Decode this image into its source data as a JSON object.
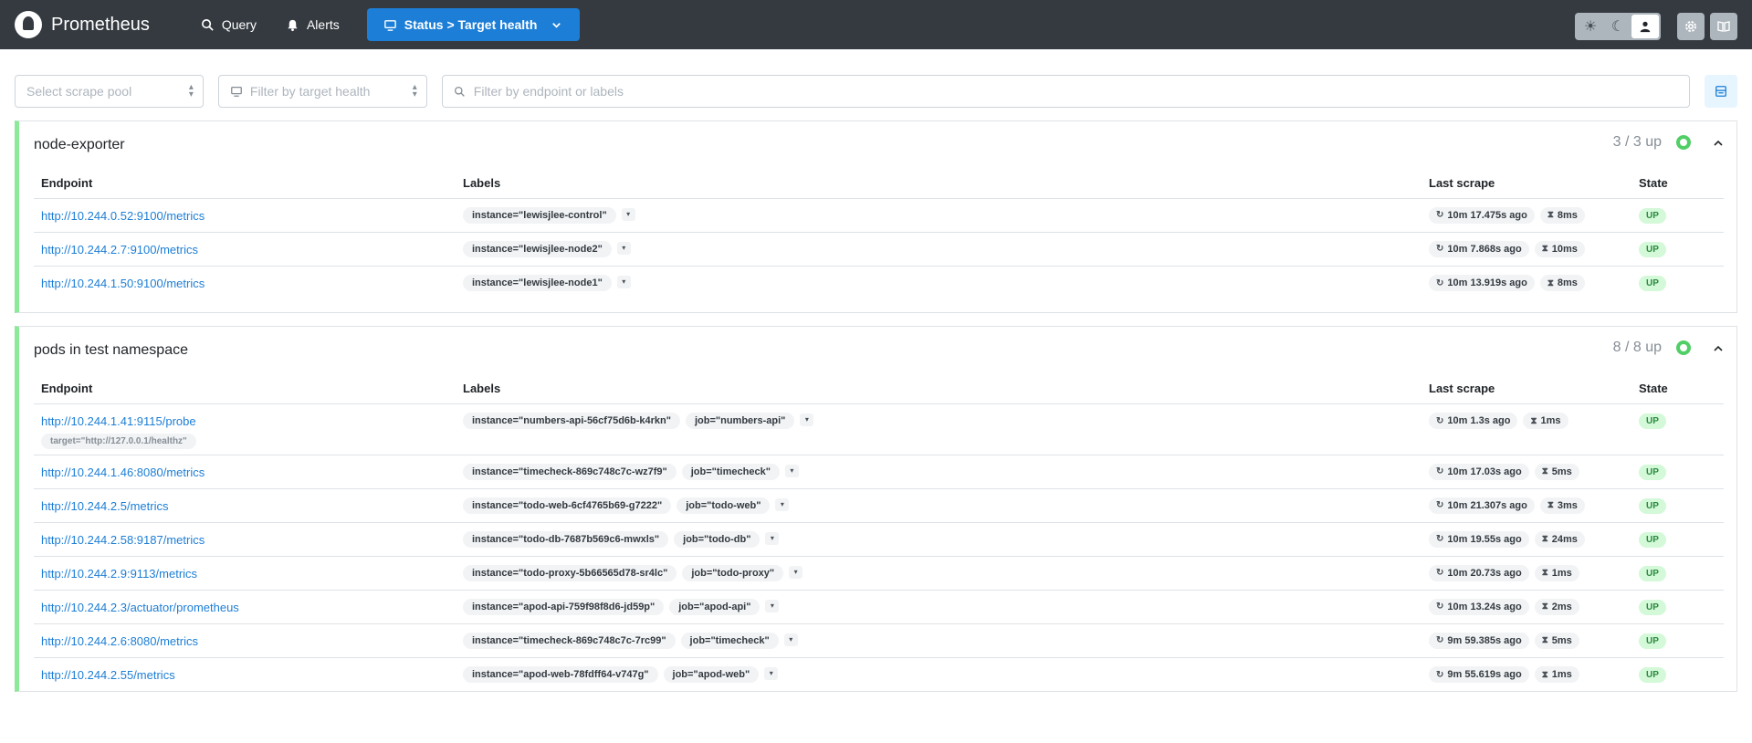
{
  "app": {
    "title": "Prometheus"
  },
  "nav": {
    "query": "Query",
    "alerts": "Alerts",
    "status": "Status > Target health"
  },
  "filters": {
    "scrape_pool_placeholder": "Select scrape pool",
    "health_placeholder": "Filter by target health",
    "search_placeholder": "Filter by endpoint or labels"
  },
  "columns": {
    "endpoint": "Endpoint",
    "labels": "Labels",
    "last_scrape": "Last scrape",
    "state": "State"
  },
  "pools": [
    {
      "name": "node-exporter",
      "count": "3 / 3 up",
      "targets": [
        {
          "endpoint": "http://10.244.0.52:9100/metrics",
          "labels": [
            "instance=\"lewisjlee-control\""
          ],
          "last": "10m 17.475s ago",
          "dur": "8ms",
          "state": "UP"
        },
        {
          "endpoint": "http://10.244.2.7:9100/metrics",
          "labels": [
            "instance=\"lewisjlee-node2\""
          ],
          "last": "10m 7.868s ago",
          "dur": "10ms",
          "state": "UP"
        },
        {
          "endpoint": "http://10.244.1.50:9100/metrics",
          "labels": [
            "instance=\"lewisjlee-node1\""
          ],
          "last": "10m 13.919s ago",
          "dur": "8ms",
          "state": "UP"
        }
      ]
    },
    {
      "name": "pods in test namespace",
      "count": "8 / 8 up",
      "targets": [
        {
          "endpoint": "http://10.244.1.41:9115/probe",
          "extra": "target=\"http://127.0.0.1/healthz\"",
          "labels": [
            "instance=\"numbers-api-56cf75d6b-k4rkn\"",
            "job=\"numbers-api\""
          ],
          "last": "10m 1.3s ago",
          "dur": "1ms",
          "state": "UP"
        },
        {
          "endpoint": "http://10.244.1.46:8080/metrics",
          "labels": [
            "instance=\"timecheck-869c748c7c-wz7f9\"",
            "job=\"timecheck\""
          ],
          "last": "10m 17.03s ago",
          "dur": "5ms",
          "state": "UP"
        },
        {
          "endpoint": "http://10.244.2.5/metrics",
          "labels": [
            "instance=\"todo-web-6cf4765b69-g7222\"",
            "job=\"todo-web\""
          ],
          "last": "10m 21.307s ago",
          "dur": "3ms",
          "state": "UP"
        },
        {
          "endpoint": "http://10.244.2.58:9187/metrics",
          "labels": [
            "instance=\"todo-db-7687b569c6-mwxls\"",
            "job=\"todo-db\""
          ],
          "last": "10m 19.55s ago",
          "dur": "24ms",
          "state": "UP"
        },
        {
          "endpoint": "http://10.244.2.9:9113/metrics",
          "labels": [
            "instance=\"todo-proxy-5b66565d78-sr4lc\"",
            "job=\"todo-proxy\""
          ],
          "last": "10m 20.73s ago",
          "dur": "1ms",
          "state": "UP"
        },
        {
          "endpoint": "http://10.244.2.3/actuator/prometheus",
          "labels": [
            "instance=\"apod-api-759f98f8d6-jd59p\"",
            "job=\"apod-api\""
          ],
          "last": "10m 13.24s ago",
          "dur": "2ms",
          "state": "UP"
        },
        {
          "endpoint": "http://10.244.2.6:8080/metrics",
          "labels": [
            "instance=\"timecheck-869c748c7c-7rc99\"",
            "job=\"timecheck\""
          ],
          "last": "9m 59.385s ago",
          "dur": "5ms",
          "state": "UP"
        },
        {
          "endpoint": "http://10.244.2.55/metrics",
          "labels": [
            "instance=\"apod-web-78fdff64-v747g\"",
            "job=\"apod-web\""
          ],
          "last": "9m 55.619s ago",
          "dur": "1ms",
          "state": "UP"
        }
      ]
    }
  ]
}
